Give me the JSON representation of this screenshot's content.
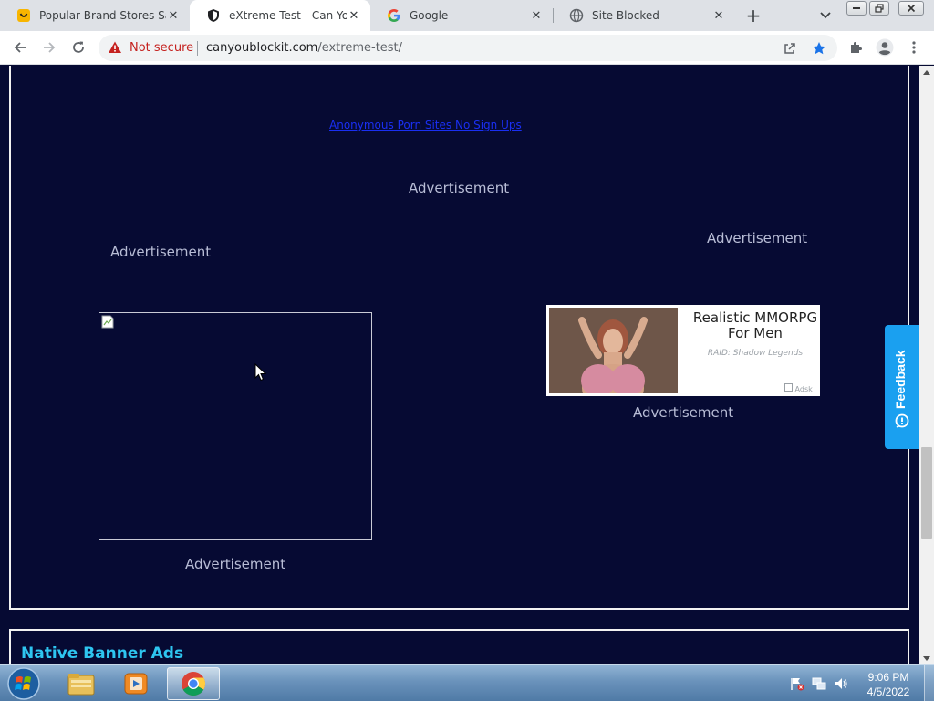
{
  "browser": {
    "tabs": [
      {
        "title": "Popular Brand Stores Sale",
        "icon": "honey-icon",
        "active": false
      },
      {
        "title": "eXtreme Test - Can You B",
        "icon": "shield-icon",
        "active": true
      },
      {
        "title": "Google",
        "icon": "google-icon",
        "active": false
      },
      {
        "title": "Site Blocked",
        "icon": "globe-icon",
        "active": false
      }
    ],
    "security_label": "Not secure",
    "url_host": "canyoublockit.com",
    "url_path": "/extreme-test/"
  },
  "page": {
    "ad_link_text": "Anonymous Porn Sites No Sign Ups",
    "advertisement_labels": [
      "Advertisement",
      "Advertisement",
      "Advertisement",
      "Advertisement",
      "Advertisement"
    ],
    "banner": {
      "headline_line1": "Realistic MMORPG",
      "headline_line2": "For Men",
      "subtitle": "RAID: Shadow Legends",
      "ad_network_badge": "Adsk"
    },
    "native_banner_title": "Native Banner Ads",
    "feedback_label": "Feedback",
    "colors": {
      "page_background": "#060a33",
      "section_heading": "#2ec5f0",
      "feedback_tab": "#1aa0f0"
    }
  },
  "taskbar": {
    "time": "9:06 PM",
    "date": "4/5/2022",
    "pinned": [
      "explorer-icon",
      "media-player-icon",
      "chrome-icon"
    ]
  }
}
